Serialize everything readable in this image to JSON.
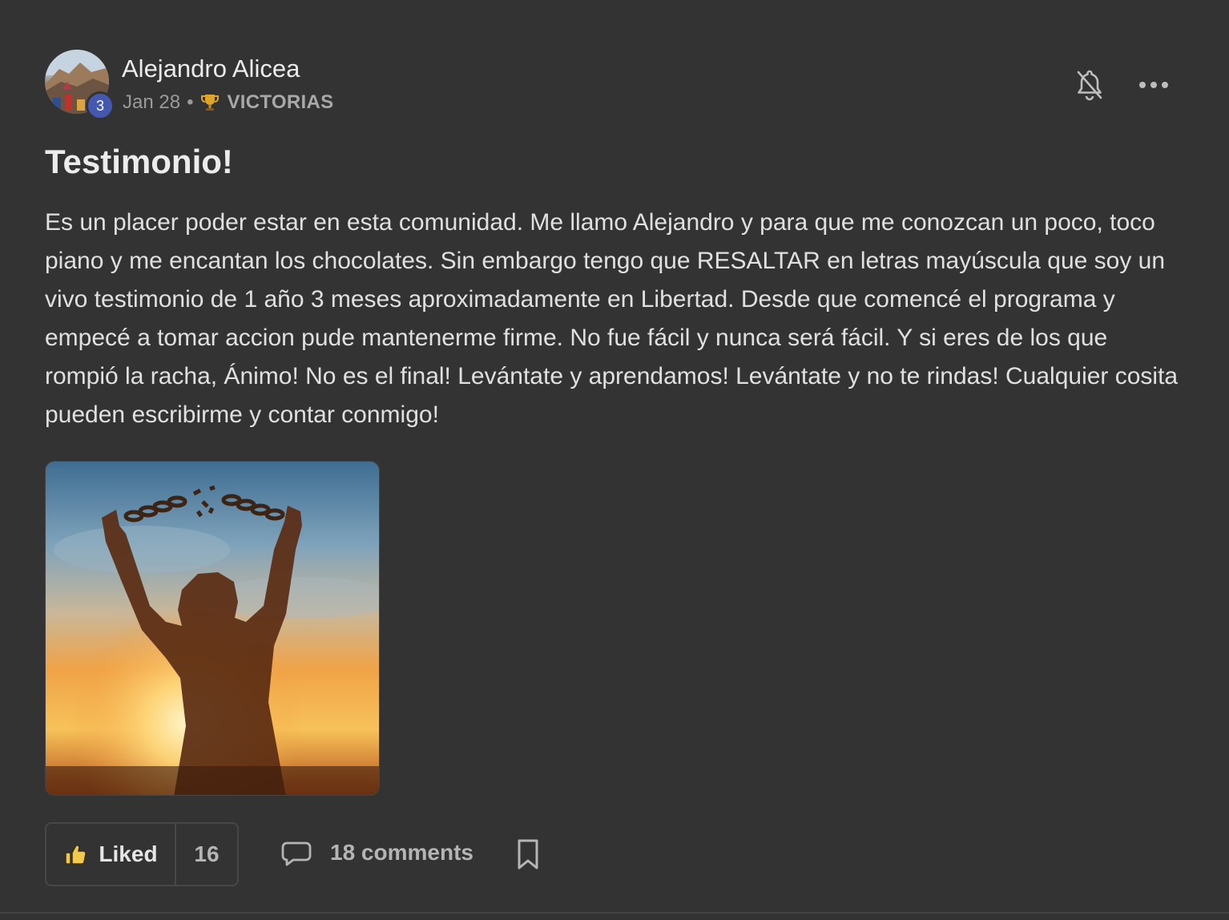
{
  "post": {
    "author": {
      "name": "Alejandro Alicea",
      "level": "3"
    },
    "date": "Jan 28",
    "separator": "•",
    "category": "VICTORIAS",
    "title": "Testimonio!",
    "body": "Es un placer poder estar en esta comunidad. Me llamo Alejandro y para que me conozcan un poco, toco piano y me encantan los chocolates. Sin embargo tengo que RESALTAR en letras mayúscula que soy un vivo testimonio de 1 año 3 meses aproximadamente en Libertad. Desde que comencé el programa y empecé a tomar accion pude mantenerme firme. No fue fácil y nunca será fácil. Y si eres de los que rompió la racha, Ánimo! No es el final! Levántate y aprendamos! Levántate y no te rindas! Cualquier cosita pueden escribirme y contar conmigo!"
  },
  "actions": {
    "like_label": "Liked",
    "like_count": "16",
    "comments_label": "18 comments"
  },
  "icons": {
    "trophy": "trophy-icon",
    "bell": "bell-off-icon",
    "more": "more-horizontal-icon",
    "thumb": "thumbs-up-icon",
    "chat": "comment-icon",
    "bookmark": "bookmark-icon"
  },
  "colors": {
    "background": "#333333",
    "level_badge": "#4458b0",
    "trophy": "#e0a526",
    "thumb": "#f2c94c"
  }
}
